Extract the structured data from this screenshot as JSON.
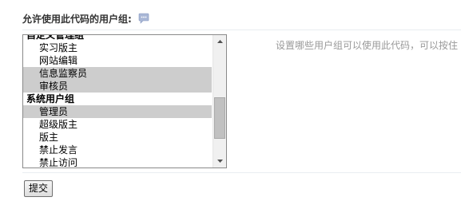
{
  "form": {
    "heading": "允许使用此代码的用户组:",
    "hint": "设置哪些用户组可以使用此代码，可以按住",
    "submit_label": "提交"
  },
  "groups": [
    {
      "label": "自定义管理组",
      "items": [
        {
          "label": "实习版主",
          "selected": false
        },
        {
          "label": "网站编辑",
          "selected": false
        },
        {
          "label": "信息监察员",
          "selected": true
        },
        {
          "label": "审核员",
          "selected": true
        }
      ]
    },
    {
      "label": "系统用户组",
      "items": [
        {
          "label": "管理员",
          "selected": true
        },
        {
          "label": "超级版主",
          "selected": false
        },
        {
          "label": "版主",
          "selected": false
        },
        {
          "label": "禁止发言",
          "selected": false
        },
        {
          "label": "禁止访问",
          "selected": false
        }
      ]
    }
  ],
  "icons": {
    "help": "help-bubble-icon",
    "scroll_up": "arrow-up-icon",
    "scroll_down": "arrow-down-icon"
  },
  "colors": {
    "selected_bg": "#cdcdcd",
    "hint_text": "#999999",
    "divider": "#e9edf1"
  }
}
